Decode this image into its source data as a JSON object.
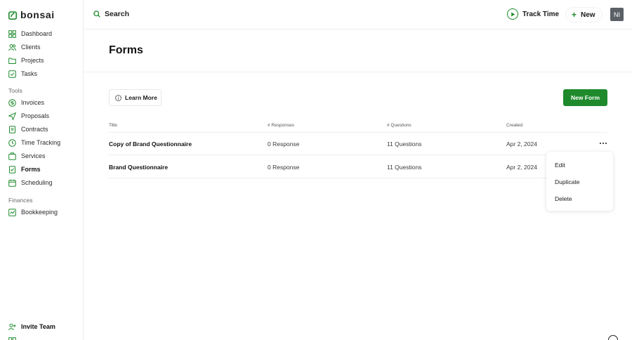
{
  "app": {
    "logo_text": "bonsai",
    "brand_color": "#1e8a2b"
  },
  "sidebar": {
    "items": [
      {
        "label": "Dashboard",
        "icon": "grid-icon"
      },
      {
        "label": "Clients",
        "icon": "users-icon"
      },
      {
        "label": "Projects",
        "icon": "folder-icon"
      },
      {
        "label": "Tasks",
        "icon": "checkbox-icon"
      }
    ],
    "tools_label": "Tools",
    "tools": [
      {
        "label": "Invoices",
        "icon": "invoice-icon"
      },
      {
        "label": "Proposals",
        "icon": "send-icon"
      },
      {
        "label": "Contracts",
        "icon": "document-icon"
      },
      {
        "label": "Time Tracking",
        "icon": "clock-icon"
      },
      {
        "label": "Services",
        "icon": "box-icon"
      },
      {
        "label": "Forms",
        "icon": "form-icon",
        "active": true
      },
      {
        "label": "Scheduling",
        "icon": "calendar-icon"
      }
    ],
    "finances_label": "Finances",
    "finances": [
      {
        "label": "Bookkeeping",
        "icon": "chart-icon"
      }
    ],
    "invite_label": "Invite Team"
  },
  "topbar": {
    "search_label": "Search",
    "track_label": "Track Time",
    "new_label": "New",
    "avatar_initials": "NI"
  },
  "page": {
    "title": "Forms",
    "learn_more_label": "Learn More",
    "new_form_label": "New Form"
  },
  "table": {
    "headers": [
      "Title",
      "# Responses",
      "# Questions",
      "Created"
    ],
    "rows": [
      {
        "title": "Copy of Brand Questionnaire",
        "responses": "0 Response",
        "questions": "11 Questions",
        "created": "Apr 2, 2024"
      },
      {
        "title": "Brand Questionnaire",
        "responses": "0 Response",
        "questions": "11 Questions",
        "created": "Apr 2, 2024"
      }
    ]
  },
  "row_menu": {
    "items": [
      "Edit",
      "Duplicate",
      "Delete"
    ]
  }
}
